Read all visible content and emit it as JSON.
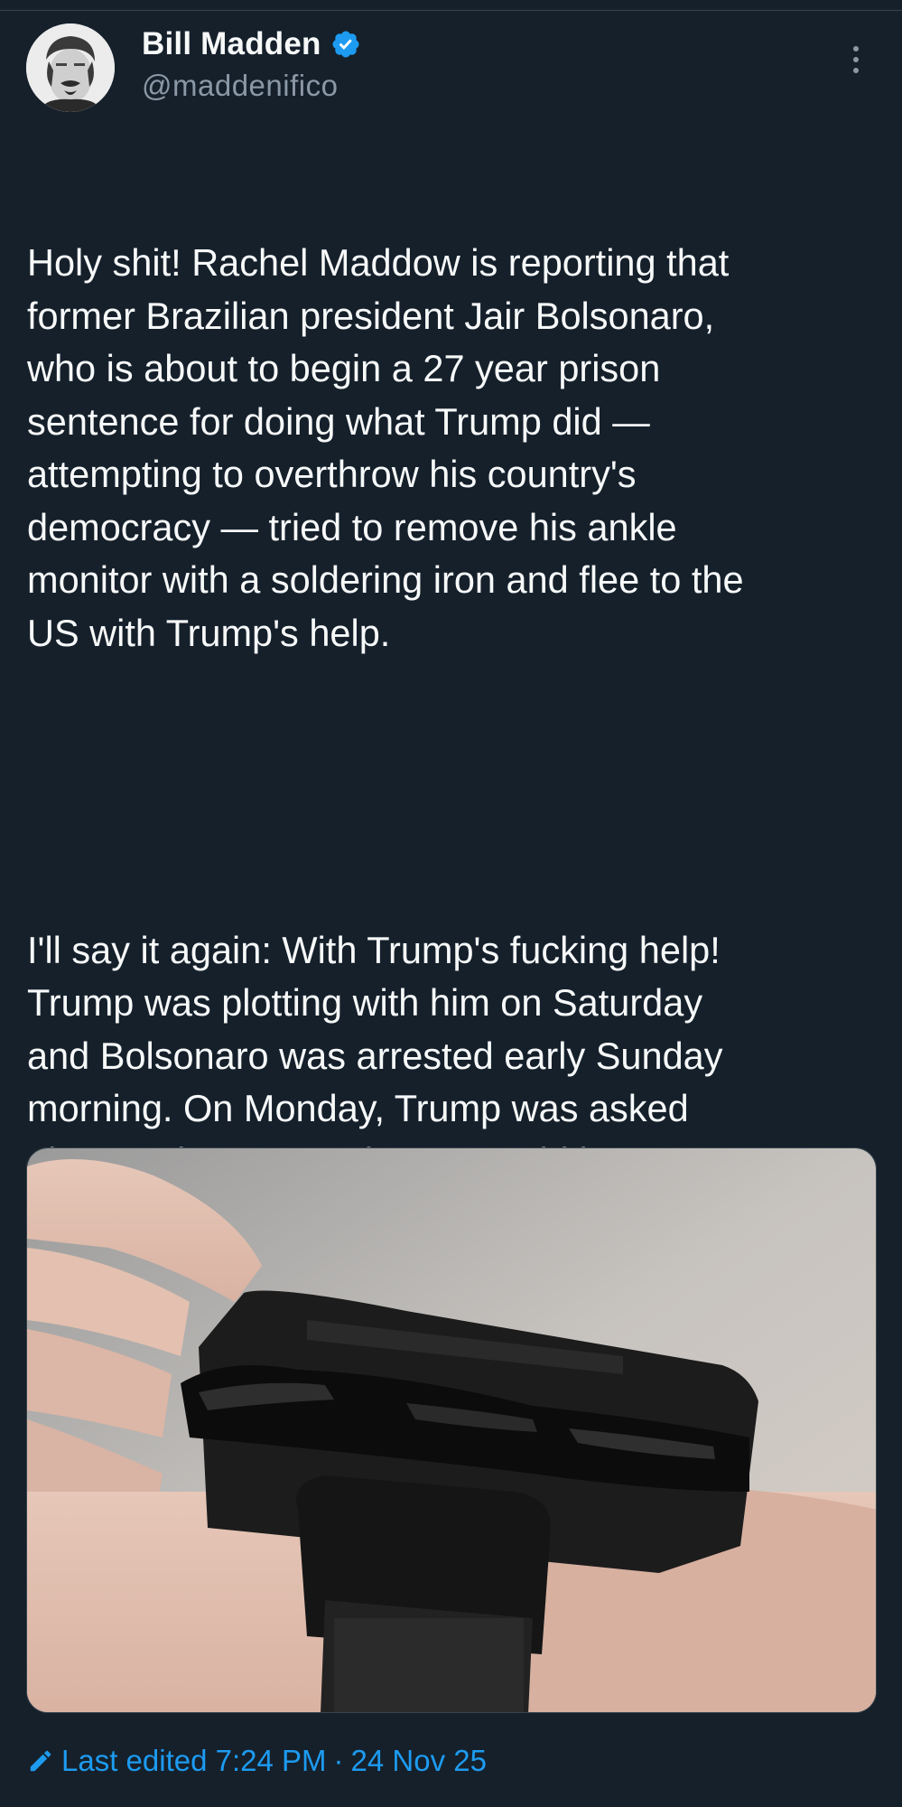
{
  "author": {
    "display_name": "Bill Madden",
    "handle": "@maddenifico",
    "verified": true,
    "avatar_icon": "user-avatar-photo",
    "verified_icon": "verified-badge-icon"
  },
  "menu": {
    "icon": "more-vertical-icon"
  },
  "tweet": {
    "paragraph_1": "Holy shit! Rachel Maddow is reporting that\nformer Brazilian president Jair Bolsonaro,\nwho is about to begin a 27 year prison\nsentence for doing what Trump did —\nattempting to overthrow his country's\ndemocracy — tried to remove his ankle\nmonitor with a soldering iron and flee to the\nUS with Trump's help.",
    "paragraph_2": "I'll say it again: With Trump's fucking help!\nTrump was plotting with him on Saturday\nand Bolsonaro was arrested early Sunday\nmorning. On Monday, Trump was asked\nabout Bolsonaro and Trump said he was\nexpecting to see him very soon. When\nreporters told Trump that Bolsonaro been\narrested, Trump appeared shocked and\ndisappointed."
  },
  "media": {
    "alt": "burned-ankle-monitor-photo"
  },
  "footer": {
    "edited_label": "Last edited 7:24 PM",
    "separator": "·",
    "date": "24 Nov 25",
    "icon": "pencil-icon"
  },
  "colors": {
    "background": "#15202b",
    "text": "#f7f9f9",
    "secondary": "#8b98a5",
    "accent": "#1d9bf0",
    "border": "#38444d"
  }
}
